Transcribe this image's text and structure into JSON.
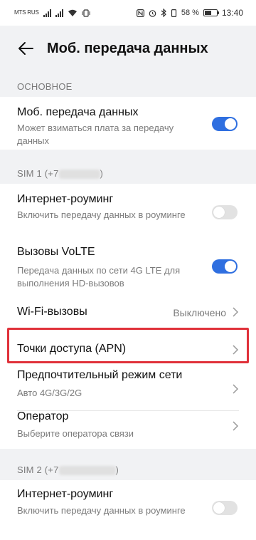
{
  "status_bar": {
    "carrier_line1": "MTS RUS",
    "carrier_line2": "",
    "carrier_badge": "",
    "battery_percent": "58 %",
    "battery_level": 0.58,
    "time": "13:40",
    "icons": [
      "nfc-icon",
      "vibrate-icon",
      "bluetooth-icon",
      "alarm-icon",
      "wifi-icon",
      "signal-icon"
    ]
  },
  "appbar": {
    "title": "Моб. передача данных"
  },
  "sections": {
    "main": {
      "label": "ОСНОВНОЕ"
    },
    "sim1": {
      "label_prefix": "SIM 1 (+7",
      "label_suffix": ")"
    },
    "sim2": {
      "label_prefix": "SIM 2 (+7",
      "label_suffix": ")"
    }
  },
  "rows": {
    "mobile_data": {
      "title": "Моб. передача данных",
      "subtitle": "Может взиматься плата за передачу данных",
      "enabled": true
    },
    "sim1_roaming": {
      "title": "Интернет-роуминг",
      "subtitle": "Включить передачу данных в роуминге",
      "enabled": false
    },
    "volte": {
      "title": "Вызовы VoLTE",
      "subtitle": "Передача данных по сети 4G LTE для выполнения HD-вызовов",
      "enabled": true
    },
    "wifi_calls": {
      "title": "Wi-Fi-вызовы",
      "value": "Выключено"
    },
    "apn": {
      "title": "Точки доступа (APN)"
    },
    "network_mode": {
      "title": "Предпочтительный режим сети",
      "subtitle": "Авто 4G/3G/2G"
    },
    "operator": {
      "title": "Оператор",
      "subtitle": "Выберите оператора связи"
    },
    "sim2_roaming": {
      "title": "Интернет-роуминг",
      "subtitle": "Включить передачу данных в роуминге",
      "enabled": false
    }
  },
  "colors": {
    "accent": "#2f6fe0",
    "highlight": "#e0313a",
    "background": "#f1f2f4"
  }
}
